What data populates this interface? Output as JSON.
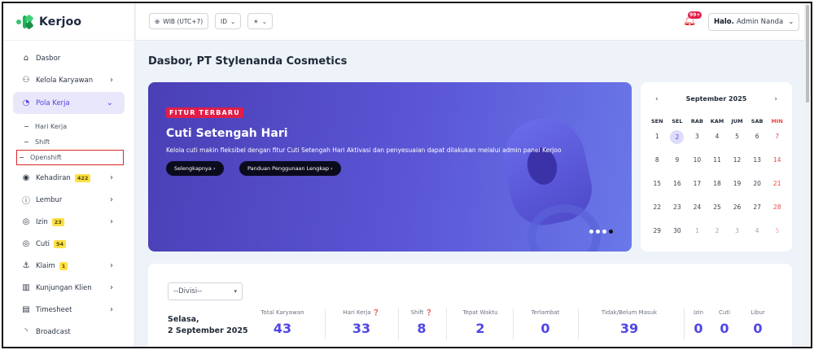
{
  "brand": {
    "name": "Kerjoo"
  },
  "sidebar": {
    "items": [
      {
        "label": "Dasbor",
        "icon": "home-icon"
      },
      {
        "label": "Kelola Karyawan",
        "icon": "users-icon"
      },
      {
        "label": "Pola Kerja",
        "icon": "clock-icon"
      },
      {
        "label": "Kehadiran",
        "icon": "location-icon",
        "badge": "422"
      },
      {
        "label": "Lembur",
        "icon": "info-icon"
      },
      {
        "label": "Izin",
        "icon": "permit-icon",
        "badge": "23"
      },
      {
        "label": "Cuti",
        "icon": "leave-icon",
        "badge": "54"
      },
      {
        "label": "Klaim",
        "icon": "claim-icon",
        "badge": "1"
      },
      {
        "label": "Kunjungan Klien",
        "icon": "building-icon"
      },
      {
        "label": "Timesheet",
        "icon": "timesheet-icon"
      },
      {
        "label": "Broadcast",
        "icon": "broadcast-icon"
      }
    ],
    "sub_items": [
      "Hari Kerja",
      "Shift",
      "Openshift"
    ]
  },
  "topbar": {
    "timezone": "WIB (UTC+7)",
    "language": "ID",
    "notif_count": "99+",
    "greeting": "Halo.",
    "user_name": "Admin Nanda"
  },
  "page": {
    "title": "Dasbor, PT Stylenanda Cosmetics"
  },
  "banner": {
    "tag": "FITUR TERBARU",
    "title": "Cuti Setengah Hari",
    "description": "Kelola cuti makin fleksibel dengan fitur Cuti Setengah Hari Aktivasi dan penyesuaian dapat dilakukan melalui admin panel Kerjoo",
    "btn_more": "Selengkapnya ›",
    "btn_guide": "Panduan Penggunaan Lengkap ›"
  },
  "calendar": {
    "month": "September 2025",
    "prev": "‹",
    "next": "›",
    "weekdays": [
      "SEN",
      "SEL",
      "RAB",
      "KAM",
      "JUM",
      "SAB",
      "MIN"
    ],
    "weeks": [
      [
        "1",
        "2",
        "3",
        "4",
        "5",
        "6",
        "7"
      ],
      [
        "8",
        "9",
        "10",
        "11",
        "12",
        "13",
        "14"
      ],
      [
        "15",
        "16",
        "17",
        "18",
        "19",
        "20",
        "21"
      ],
      [
        "22",
        "23",
        "24",
        "25",
        "26",
        "27",
        "28"
      ],
      [
        "29",
        "30",
        "1",
        "2",
        "3",
        "4",
        "5"
      ]
    ],
    "today": "2"
  },
  "stats": {
    "division_select": "--Divisi--",
    "date_line1": "Selasa,",
    "date_line2": "2 September 2025",
    "items": [
      {
        "label": "Total Karyawan",
        "value": "43"
      },
      {
        "label": "Hari Kerja ❓",
        "value": "33"
      },
      {
        "label": "Shift ❓",
        "value": "8"
      },
      {
        "label": "Tepat Waktu",
        "value": "2"
      },
      {
        "label": "Terlambat",
        "value": "0"
      },
      {
        "label": "Tidak/Belum Masuk",
        "value": "39"
      },
      {
        "label": "Izin",
        "value": "0"
      },
      {
        "label": "Cuti",
        "value": "0"
      },
      {
        "label": "Libur",
        "value": "0"
      }
    ]
  }
}
